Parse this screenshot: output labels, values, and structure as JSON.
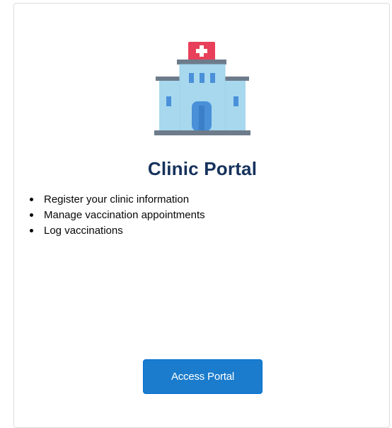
{
  "card": {
    "icon": "hospital-icon",
    "title": "Clinic Portal",
    "features": [
      "Register your clinic information",
      "Manage vaccination appointments",
      "Log vaccinations"
    ],
    "action_label": "Access Portal"
  },
  "colors": {
    "title": "#16325c",
    "button": "#1b7ccd",
    "building": "#a7d8ee",
    "cross_sign": "#e8405a"
  }
}
